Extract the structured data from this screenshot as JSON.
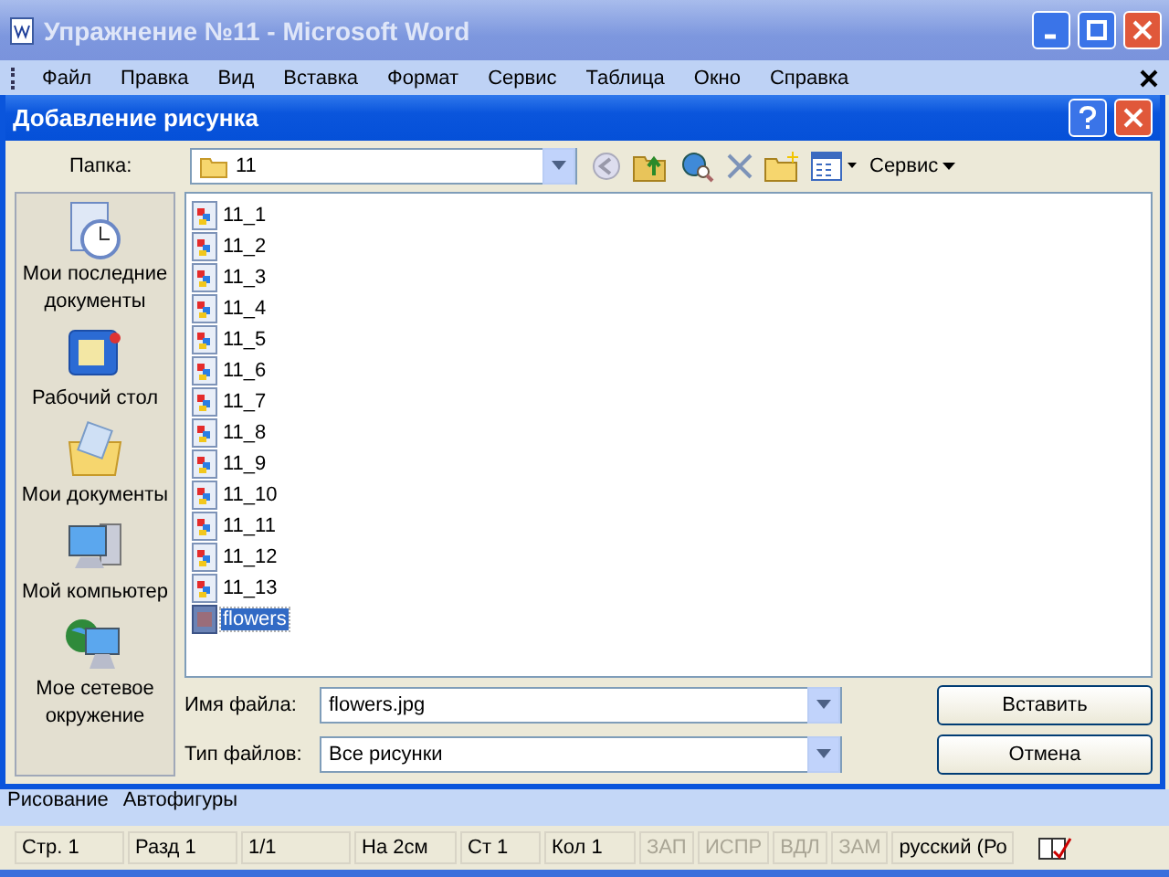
{
  "window": {
    "title": "Упражнение №11 - Microsoft Word"
  },
  "menu": [
    "Файл",
    "Правка",
    "Вид",
    "Вставка",
    "Формат",
    "Сервис",
    "Таблица",
    "Окно",
    "Справка"
  ],
  "dialog": {
    "title": "Добавление рисунка",
    "folder_label": "Папка:",
    "folder": "11",
    "tools_label": "Сервис",
    "places": [
      {
        "kind": "recent",
        "label": "Мои последние документы"
      },
      {
        "kind": "desktop",
        "label": "Рабочий стол"
      },
      {
        "kind": "documents",
        "label": "Мои документы"
      },
      {
        "kind": "computer",
        "label": "Мой компьютер"
      },
      {
        "kind": "network",
        "label": "Мое сетевое окружение"
      }
    ],
    "files": [
      {
        "name": "11_1",
        "kind": "image",
        "selected": false
      },
      {
        "name": "11_2",
        "kind": "image",
        "selected": false
      },
      {
        "name": "11_3",
        "kind": "image",
        "selected": false
      },
      {
        "name": "11_4",
        "kind": "image",
        "selected": false
      },
      {
        "name": "11_5",
        "kind": "image",
        "selected": false
      },
      {
        "name": "11_6",
        "kind": "image",
        "selected": false
      },
      {
        "name": "11_7",
        "kind": "image",
        "selected": false
      },
      {
        "name": "11_8",
        "kind": "image",
        "selected": false
      },
      {
        "name": "11_9",
        "kind": "image",
        "selected": false
      },
      {
        "name": "11_10",
        "kind": "image",
        "selected": false
      },
      {
        "name": "11_11",
        "kind": "image",
        "selected": false
      },
      {
        "name": "11_12",
        "kind": "image",
        "selected": false
      },
      {
        "name": "11_13",
        "kind": "image",
        "selected": false
      },
      {
        "name": "flowers",
        "kind": "photo",
        "selected": true
      }
    ],
    "filename_label": "Имя файла:",
    "filename": "flowers.jpg",
    "filetype_label": "Тип файлов:",
    "filetype": "Все рисунки",
    "buttons": [
      "Вставить",
      "Отмена"
    ]
  },
  "drawing_toolbar": [
    "Рисование",
    "Автофигуры"
  ],
  "status_bar": [
    {
      "text": "Стр. 1",
      "disabled": false
    },
    {
      "text": "Разд 1",
      "disabled": false
    },
    {
      "text": "1/1",
      "disabled": false
    },
    {
      "text": "На 2см",
      "disabled": false
    },
    {
      "text": "Ст 1",
      "disabled": false
    },
    {
      "text": "Кол 1",
      "disabled": false
    },
    {
      "text": "ЗАП",
      "disabled": true
    },
    {
      "text": "ИСПР",
      "disabled": true
    },
    {
      "text": "ВДЛ",
      "disabled": true
    },
    {
      "text": "ЗАМ",
      "disabled": true
    },
    {
      "text": "русский (Ро",
      "disabled": false
    }
  ]
}
